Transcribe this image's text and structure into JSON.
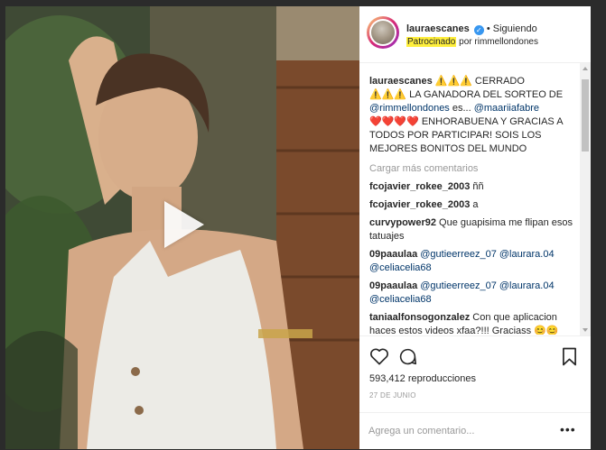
{
  "post": {
    "username": "lauraescanes",
    "verified_icon": "verified-check-icon",
    "follow_sep": "•",
    "follow_status": "Siguiendo",
    "sponsored_label": "Patrocinado",
    "sponsored_by_prefix": "por",
    "sponsor": "rimmellondones"
  },
  "caption": {
    "username": "lauraescanes",
    "line1_text": "⚠️⚠️⚠️ CERRADO",
    "line2_text": "⚠️⚠️⚠️ LA GANADORA DEL SORTEO DE",
    "mention1": "@rimmellondones",
    "mid_text": " es... ",
    "mention2": "@maariiafabre",
    "line4_text": "❤️❤️❤️❤️ ENHORABUENA Y GRACIAS A",
    "line5_text": "TODOS POR PARTICIPAR! SOIS LOS",
    "line6_text": "MEJORES BONITOS DEL MUNDO"
  },
  "load_more": "Cargar más comentarios",
  "comments": [
    {
      "user": "fcojavier_rokee_2003",
      "text": " ññ"
    },
    {
      "user": "fcojavier_rokee_2003",
      "text": " a"
    },
    {
      "user": "curvypower92",
      "text": " Que guapisima me flipan esos tatuajes"
    },
    {
      "user": "09paaulaa",
      "mention_a": "@gutieerreez_07",
      "mention_b": "@laurara.04",
      "mention_c": "@celiacelia68"
    },
    {
      "user": "09paaulaa",
      "mention_a": "@gutieerreez_07",
      "mention_b": "@laurara.04",
      "mention_c": "@celiacelia68"
    },
    {
      "user": "taniaalfonsogonzalez",
      "text": " Con que aplicacion haces estos videos xfaa?!!! Graciass 😊😊"
    }
  ],
  "actions": {
    "like_icon": "heart-outline-icon",
    "comment_icon": "comment-bubble-icon",
    "save_icon": "bookmark-icon"
  },
  "views": "593,412 reproducciones",
  "date": "27 DE JUNIO",
  "add_comment": {
    "placeholder": "Agrega un comentario...",
    "more_label": "•••"
  },
  "colors": {
    "link": "#003569",
    "muted": "#999999",
    "sponsored_highlight": "#ffef3c",
    "verified": "#3897f0"
  }
}
